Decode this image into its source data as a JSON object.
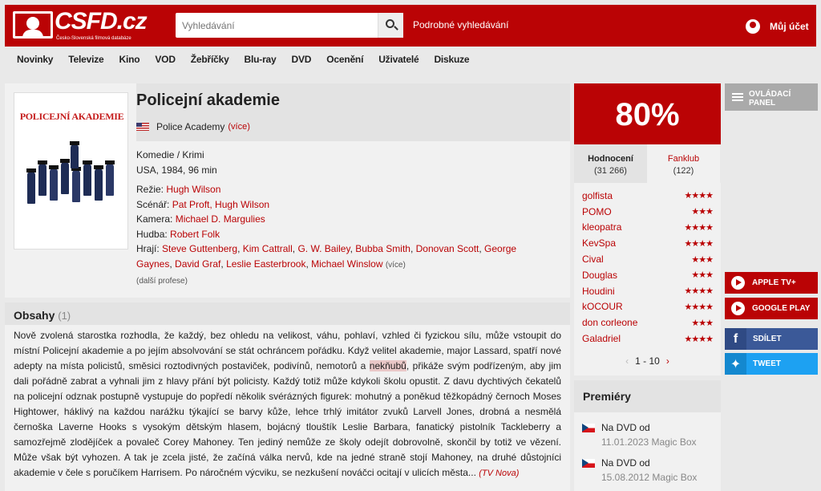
{
  "header": {
    "logo_text": "CSFD.cz",
    "logo_tagline": "Česko-Slovenská filmová databáze",
    "search_placeholder": "Vyhledávání",
    "advanced_search": "Podrobné vyhledávání",
    "account": "Můj účet",
    "brand_color": "#ba0305"
  },
  "nav": [
    "Novinky",
    "Televize",
    "Kino",
    "VOD",
    "Žebříčky",
    "Blu-ray",
    "DVD",
    "Ocenění",
    "Uživatelé",
    "Diskuze"
  ],
  "film": {
    "title": "Policejní akademie",
    "poster_title": "POLICEJNÍ AKADEMIE",
    "original_title": "Police Academy",
    "more": "(více)",
    "genre": "Komedie / Krimi",
    "origin": "USA, 1984, 96 min",
    "director_label": "Režie:",
    "director": "Hugh Wilson",
    "writer_label": "Scénář:",
    "writers": "Pat Proft, Hugh Wilson",
    "camera_label": "Kamera:",
    "camera": "Michael D. Margulies",
    "music_label": "Hudba:",
    "music": "Robert Folk",
    "cast_label": "Hrají:",
    "cast": [
      "Steve Guttenberg",
      "Kim Cattrall",
      "G. W. Bailey",
      "Bubba Smith",
      "Donovan Scott",
      "George Gaynes",
      "David Graf",
      "Leslie Easterbrook",
      "Michael Winslow"
    ],
    "cast_more": "(více)",
    "more_professions": "(další profese)"
  },
  "plot": {
    "heading": "Obsahy",
    "count": "(1)",
    "text_before": "Nově zvolená starostka rozhodla, že každý, bez ohledu na velikost, váhu, pohlaví, vzhled či fyzickou sílu, může vstoupit do místní Policejní akademie a po jejím absolvování se stát ochráncem pořádku. Když velitel akademie, major Lassard, spatří nové adepty na místa policistů, směsici roztodivných postaviček, podivínů, nemotorů a ",
    "highlight": "nekňubů",
    "text_after": ", přikáže svým podřízeným, aby jim dali pořádně zabrat a vyhnali jim z hlavy přání být policisty. Každý totiž může kdykoli školu opustit. Z davu dychtivých čekatelů na policejní odznak postupně vystupuje do popředí několik svérázných figurek: mohutný a poněkud těžkopádný černoch Moses Hightower, háklivý na každou narážku týkající se barvy kůže, lehce trhlý imitátor zvuků Larvell Jones, drobná a nesmělá černoška Laverne Hooks s vysokým dětským hlasem, bojácný tlouštík Leslie Barbara, fanatický pistolník Tackleberry a samozřejmě zlodějíček a povaleč Corey Mahoney. Ten jediný nemůže ze školy odejít dobrovolně, skončil by totiž ve vězení. Může však být vyhozen. A tak je zcela jisté, že začíná válka nervů, kde na jedné straně stojí Mahoney, na druhé důstojníci akademie v čele s poručíkem Harrisem. Po náročném výcviku, se nezkušení nováčci ocitají v ulicích města...",
    "source": "(TV Nova)"
  },
  "rating": {
    "value": "80%",
    "value_num": 80,
    "tab_ratings": "Hodnocení",
    "tab_ratings_count": "(31 266)",
    "tab_fanclub": "Fanklub",
    "tab_fanclub_count": "(122)",
    "users": [
      {
        "name": "golfista",
        "stars": "★★★★",
        "n": 4
      },
      {
        "name": "POMO",
        "stars": "★★★",
        "n": 3
      },
      {
        "name": "kleopatra",
        "stars": "★★★★",
        "n": 4
      },
      {
        "name": "KevSpa",
        "stars": "★★★★",
        "n": 4
      },
      {
        "name": "Cival",
        "stars": "★★★",
        "n": 3
      },
      {
        "name": "Douglas",
        "stars": "★★★",
        "n": 3
      },
      {
        "name": "Houdini",
        "stars": "★★★★",
        "n": 4
      },
      {
        "name": "kOCOUR",
        "stars": "★★★★",
        "n": 4
      },
      {
        "name": "don corleone",
        "stars": "★★★",
        "n": 3
      },
      {
        "name": "Galadriel",
        "stars": "★★★★",
        "n": 4
      }
    ],
    "pager": "1 - 10",
    "prev": "‹",
    "next": "›"
  },
  "premieres": {
    "heading": "Premiéry",
    "items": [
      {
        "label": "Na DVD od",
        "date": "11.01.2023 Magic Box"
      },
      {
        "label": "Na DVD od",
        "date": "15.08.2012 Magic Box"
      }
    ]
  },
  "side": {
    "panel": "OVLÁDACÍ PANEL",
    "apple": "APPLE TV+",
    "google": "GOOGLE PLAY",
    "share": "SDÍLET",
    "tweet": "TWEET"
  }
}
